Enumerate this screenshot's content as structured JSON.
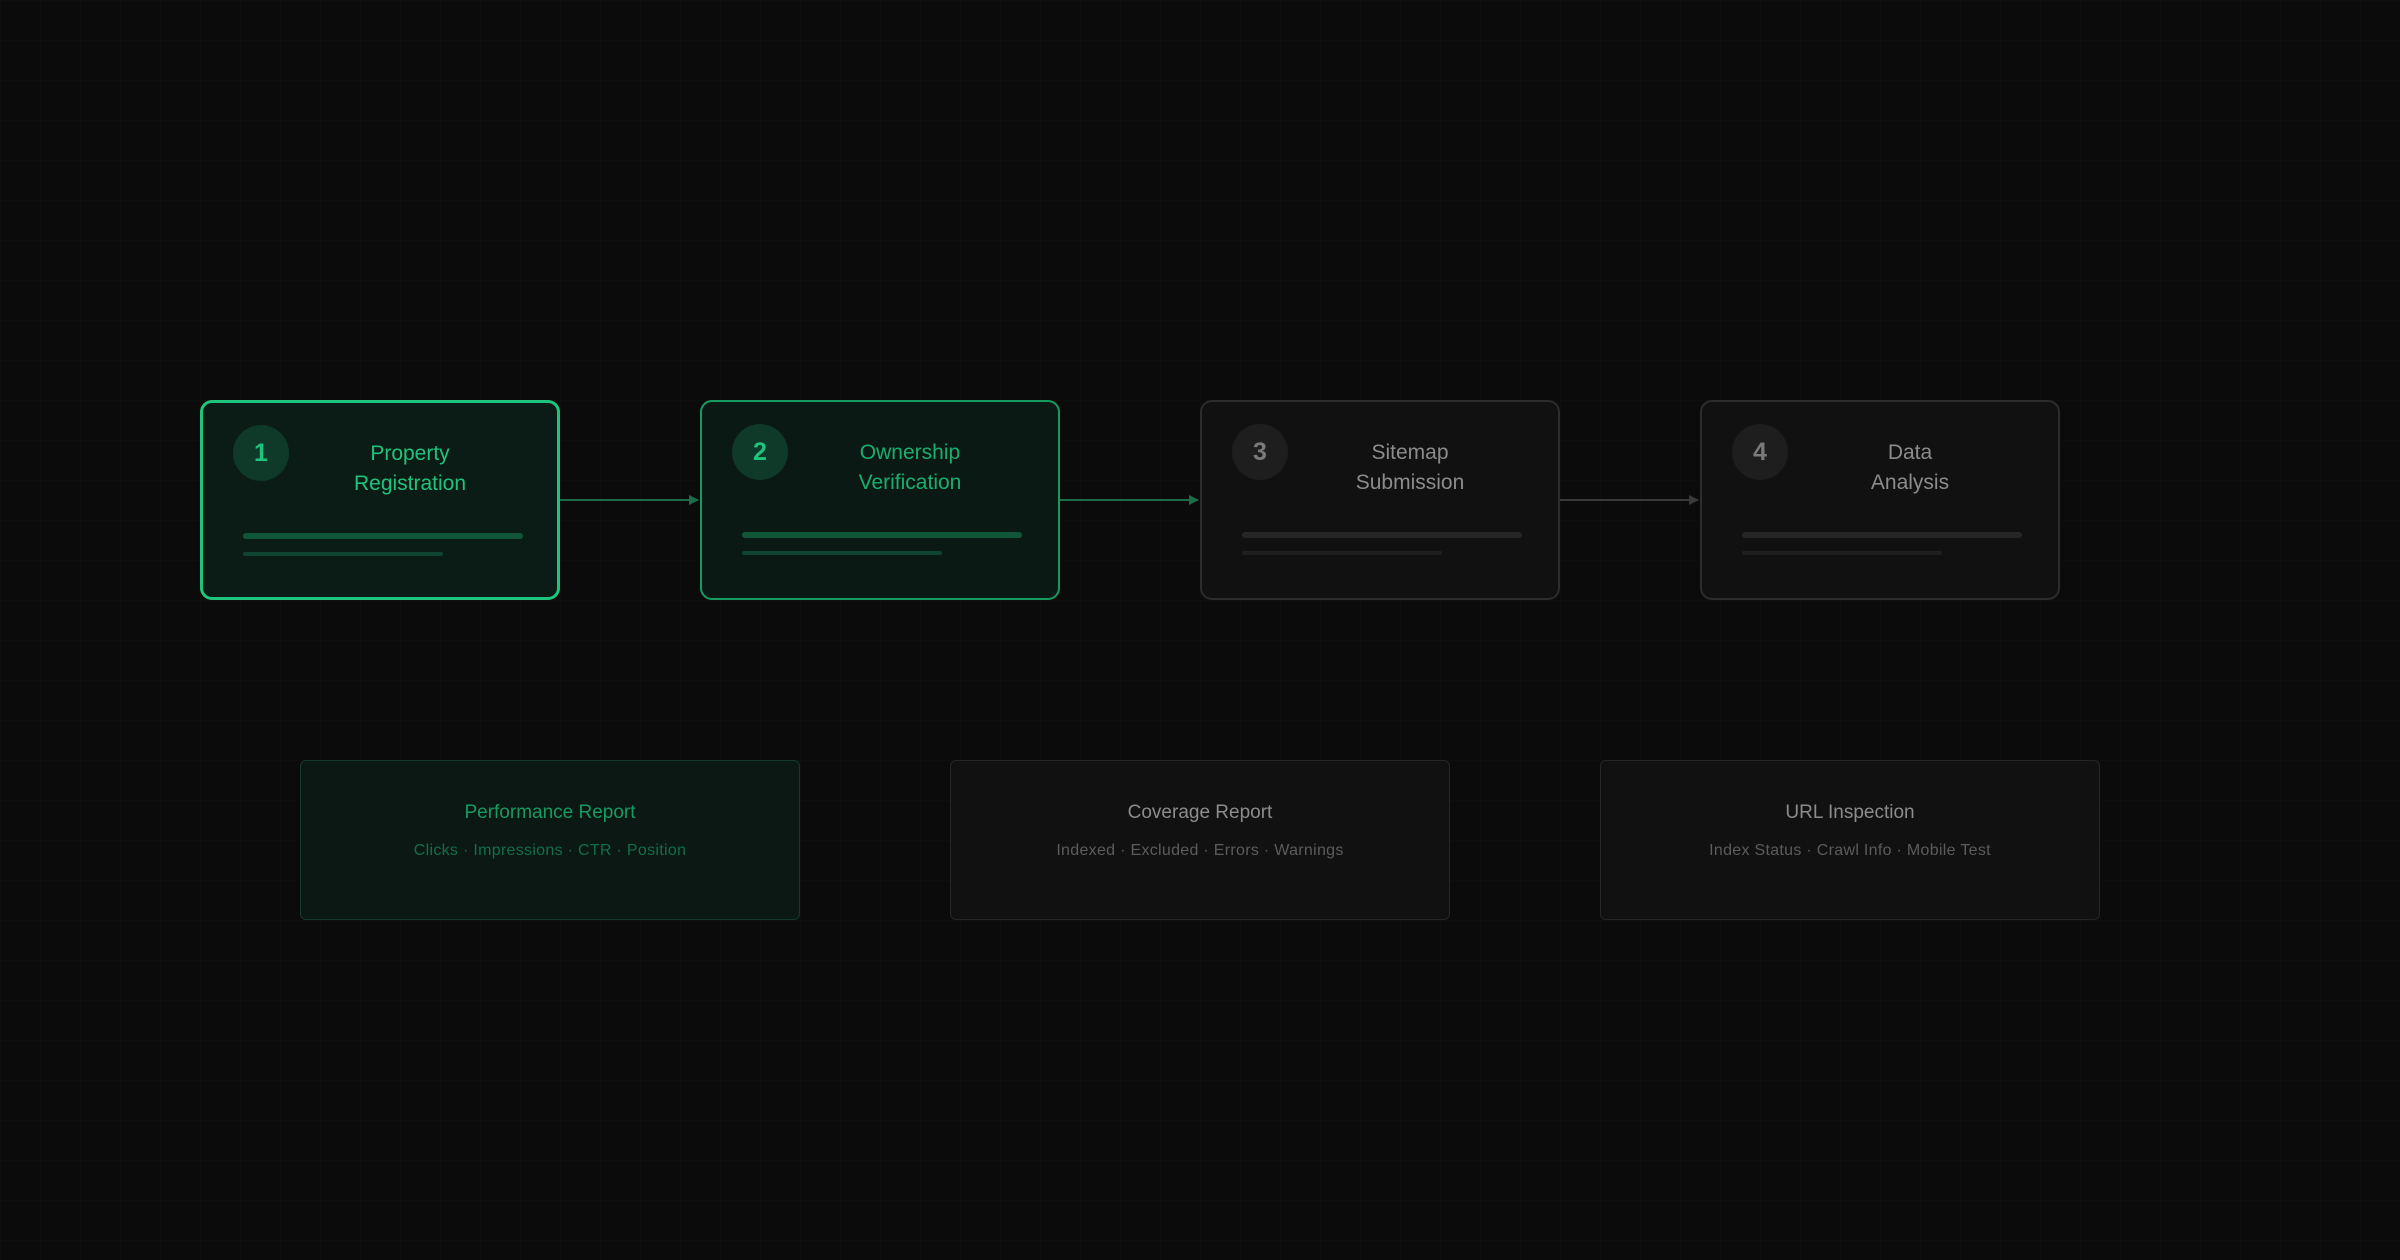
{
  "steps": [
    {
      "number": "1",
      "title_lines": [
        "Property",
        "Registration"
      ],
      "state": "active"
    },
    {
      "number": "2",
      "title_lines": [
        "Ownership",
        "Verification"
      ],
      "state": "complete"
    },
    {
      "number": "3",
      "title_lines": [
        "Sitemap",
        "Submission"
      ],
      "state": "pending"
    },
    {
      "number": "4",
      "title_lines": [
        "Data",
        "Analysis"
      ],
      "state": "pending"
    }
  ],
  "reports": [
    {
      "title": "Performance Report",
      "subtitle": "Clicks · Impressions · CTR · Position"
    },
    {
      "title": "Coverage Report",
      "subtitle": "Indexed · Excluded · Errors · Warnings"
    },
    {
      "title": "URL Inspection",
      "subtitle": "Index Status · Crawl Info · Mobile Test"
    }
  ],
  "colors": {
    "background": "#0b0b0b",
    "accent_green": "#1fc47c",
    "muted_green": "#169b62",
    "pending_border": "#2c2c2c",
    "connector_green": "#1e6b49",
    "connector_gray": "#3a3a3a"
  }
}
